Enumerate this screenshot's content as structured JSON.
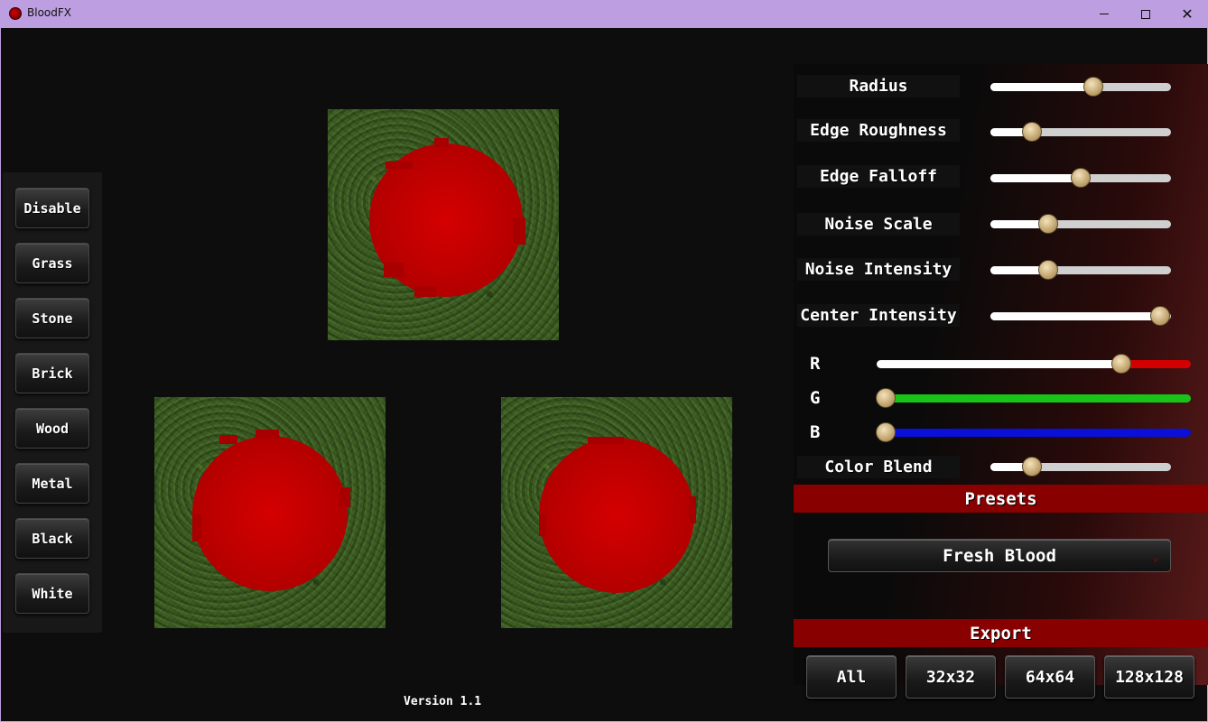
{
  "window": {
    "title": "BloodFX",
    "minimize": "—",
    "maximize": "□",
    "close": "✕"
  },
  "materials": [
    "Disable",
    "Grass",
    "Stone",
    "Brick",
    "Wood",
    "Metal",
    "Black",
    "White"
  ],
  "sliders": [
    {
      "label": "Radius",
      "value": 0.57
    },
    {
      "label": "Edge Roughness",
      "value": 0.23
    },
    {
      "label": "Edge Falloff",
      "value": 0.5
    },
    {
      "label": "Noise Scale",
      "value": 0.32
    },
    {
      "label": "Noise Intensity",
      "value": 0.32
    },
    {
      "label": "Center Intensity",
      "value": 0.94
    }
  ],
  "color": {
    "r": {
      "label": "R",
      "value": 0.78,
      "color": "#d40000"
    },
    "g": {
      "label": "G",
      "value": 0.03,
      "color": "#19c419"
    },
    "b": {
      "label": "B",
      "value": 0.03,
      "color": "#0a10d8"
    }
  },
  "color_blend": {
    "label": "Color Blend",
    "value": 0.23
  },
  "presets": {
    "header": "Presets",
    "selected": "Fresh Blood"
  },
  "export": {
    "header": "Export",
    "buttons": [
      "All",
      "32x32",
      "64x64",
      "128x128"
    ]
  },
  "version": "Version 1.1"
}
